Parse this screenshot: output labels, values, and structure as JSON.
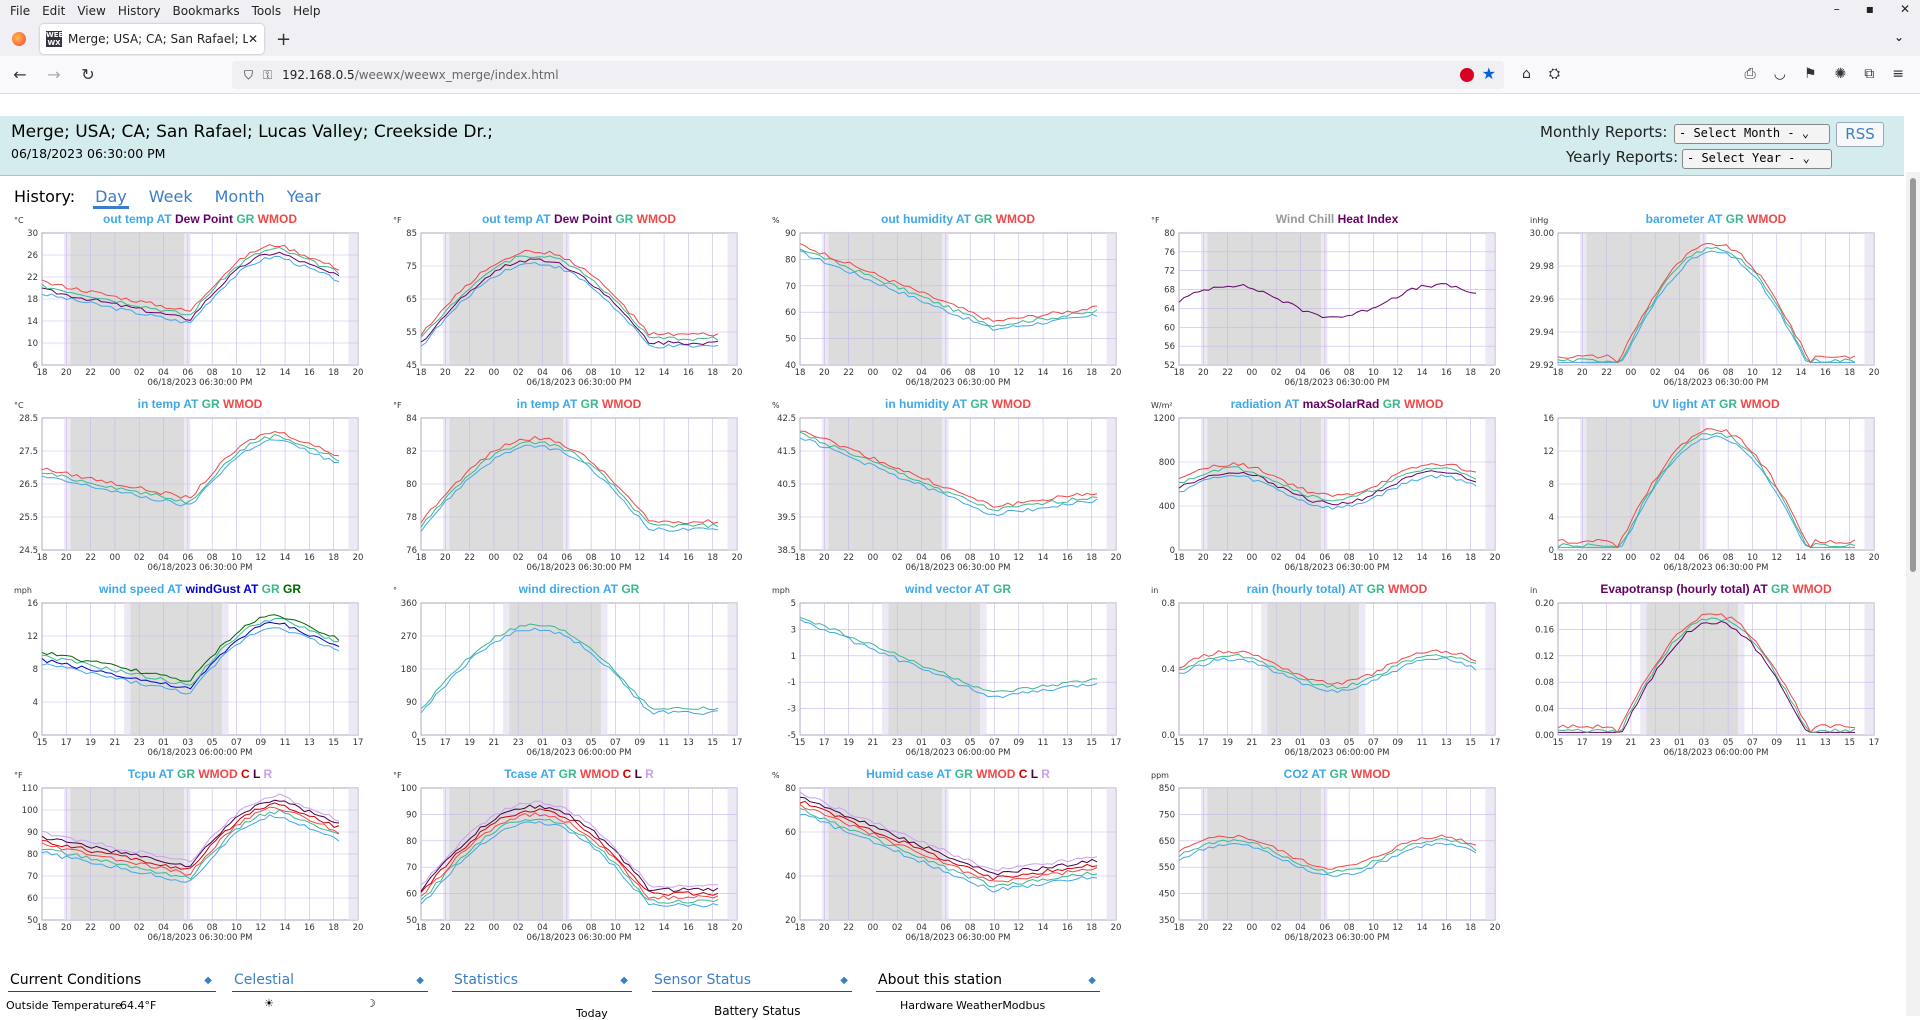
{
  "browser": {
    "menu": [
      "File",
      "Edit",
      "View",
      "History",
      "Bookmarks",
      "Tools",
      "Help"
    ],
    "window_controls": [
      "–",
      "▪",
      "✕"
    ],
    "tab_title": "Merge; USA; CA; San Rafael; Lucas Valley; Creekside Dr.;",
    "tab_favicon_text": "WEE WX",
    "url_host": "192.168.0.5",
    "url_path": "/weewx/weewx_merge/index.html"
  },
  "header": {
    "title": "Merge; USA; CA; San Rafael; Lucas Valley; Creekside Dr.;",
    "time": "06/18/2023 06:30:00 PM",
    "monthly_label": "Monthly Reports:",
    "monthly_select": "- Select Month -",
    "yearly_label": "Yearly Reports:",
    "yearly_select": "- Select Year -",
    "rss": "RSS"
  },
  "history": {
    "label": "History:",
    "tabs": [
      "Day",
      "Week",
      "Month",
      "Year"
    ],
    "active": "Day"
  },
  "colors": {
    "at": "#40a8e8",
    "gr": "#3bb88c",
    "wmod": "#f04848",
    "dew": "#660066",
    "gust": "#0000cc",
    "grgust": "#006600",
    "c": "#cc0000",
    "l": "#440044",
    "r": "#c8a0f0"
  },
  "axis_hours_a": [
    "18",
    "20",
    "22",
    "00",
    "02",
    "04",
    "06",
    "08",
    "10",
    "12",
    "14",
    "16",
    "18",
    "20"
  ],
  "axis_hours_b": [
    "15",
    "17",
    "19",
    "21",
    "23",
    "01",
    "03",
    "05",
    "07",
    "09",
    "11",
    "13",
    "15",
    "17"
  ],
  "caption_a": "06/18/2023 06:30:00 PM",
  "caption_b": "06/18/2023 06:00:00 PM",
  "plots": [
    {
      "unit": "°C",
      "yticks": [
        "30",
        "26",
        "22",
        "18",
        "14",
        "10",
        "6"
      ],
      "axis": "a",
      "title": [
        [
          "out temp AT ",
          "at"
        ],
        [
          "Dew Point ",
          "dew"
        ],
        [
          "GR ",
          "gr"
        ],
        [
          "WMOD",
          "wmod"
        ]
      ]
    },
    {
      "unit": "°F",
      "yticks": [
        "85",
        "75",
        "65",
        "55",
        "45"
      ],
      "axis": "a",
      "title": [
        [
          "out temp AT ",
          "at"
        ],
        [
          "Dew Point ",
          "dew"
        ],
        [
          "GR ",
          "gr"
        ],
        [
          "WMOD",
          "wmod"
        ]
      ]
    },
    {
      "unit": "%",
      "yticks": [
        "90",
        "80",
        "70",
        "60",
        "50",
        "40"
      ],
      "axis": "a",
      "title": [
        [
          "out humidity AT ",
          "at"
        ],
        [
          "GR ",
          "gr"
        ],
        [
          "WMOD",
          "wmod"
        ]
      ]
    },
    {
      "unit": "°F",
      "yticks": [
        "80",
        "76",
        "72",
        "68",
        "64",
        "60",
        "56",
        "52"
      ],
      "axis": "a",
      "title": [
        [
          "Wind Chill ",
          "grey"
        ],
        [
          "Heat Index",
          "dew"
        ]
      ]
    },
    {
      "unit": "inHg",
      "yticks": [
        "30.00",
        "29.98",
        "29.96",
        "29.94",
        "29.92"
      ],
      "axis": "a",
      "title": [
        [
          "barometer AT ",
          "at"
        ],
        [
          "GR ",
          "gr"
        ],
        [
          "WMOD",
          "wmod"
        ]
      ]
    },
    {
      "unit": "°C",
      "yticks": [
        "28.5",
        "27.5",
        "26.5",
        "25.5",
        "24.5"
      ],
      "axis": "a",
      "title": [
        [
          "in temp AT ",
          "at"
        ],
        [
          "GR ",
          "gr"
        ],
        [
          "WMOD",
          "wmod"
        ]
      ]
    },
    {
      "unit": "°F",
      "yticks": [
        "84",
        "82",
        "80",
        "78",
        "76"
      ],
      "axis": "a",
      "title": [
        [
          "in temp AT ",
          "at"
        ],
        [
          "GR ",
          "gr"
        ],
        [
          "WMOD",
          "wmod"
        ]
      ]
    },
    {
      "unit": "%",
      "yticks": [
        "42.5",
        "41.5",
        "40.5",
        "39.5",
        "38.5"
      ],
      "axis": "a",
      "title": [
        [
          "in humidity AT ",
          "at"
        ],
        [
          "GR ",
          "gr"
        ],
        [
          "WMOD",
          "wmod"
        ]
      ]
    },
    {
      "unit": "W/m²",
      "yticks": [
        "1200",
        "800",
        "400",
        "0"
      ],
      "axis": "a",
      "title": [
        [
          "radiation AT ",
          "at"
        ],
        [
          "maxSolarRad ",
          "dew"
        ],
        [
          "GR ",
          "gr"
        ],
        [
          "WMOD",
          "wmod"
        ]
      ]
    },
    {
      "unit": "",
      "yticks": [
        "16",
        "12",
        "8",
        "4",
        "0"
      ],
      "axis": "a",
      "title": [
        [
          "UV light AT ",
          "at"
        ],
        [
          "GR ",
          "gr"
        ],
        [
          "WMOD",
          "wmod"
        ]
      ]
    },
    {
      "unit": "mph",
      "yticks": [
        "16",
        "12",
        "8",
        "4",
        "0"
      ],
      "axis": "b",
      "title": [
        [
          "wind speed AT ",
          "at"
        ],
        [
          "windGust AT ",
          "gust"
        ],
        [
          "GR ",
          "gr"
        ],
        [
          "GR",
          "grgust"
        ]
      ]
    },
    {
      "unit": "°",
      "yticks": [
        "360",
        "270",
        "180",
        "90",
        "0"
      ],
      "axis": "b",
      "title": [
        [
          "wind direction AT ",
          "at"
        ],
        [
          "GR",
          "gr"
        ]
      ]
    },
    {
      "unit": "mph",
      "yticks": [
        "5",
        "3",
        "1",
        "-1",
        "-3",
        "-5"
      ],
      "axis": "b",
      "title": [
        [
          "wind vector AT ",
          "at"
        ],
        [
          "GR",
          "gr"
        ]
      ]
    },
    {
      "unit": "in",
      "yticks": [
        "0.8",
        "0.4",
        "0.0"
      ],
      "axis": "b",
      "title": [
        [
          "rain (hourly total) AT ",
          "at"
        ],
        [
          "GR ",
          "gr"
        ],
        [
          "WMOD",
          "wmod"
        ]
      ]
    },
    {
      "unit": "in",
      "yticks": [
        "0.20",
        "0.16",
        "0.12",
        "0.08",
        "0.04",
        "0.00"
      ],
      "axis": "b",
      "title": [
        [
          "Evapotransp (hourly total) AT ",
          "dew"
        ],
        [
          "GR ",
          "gr"
        ],
        [
          "WMOD",
          "wmod"
        ]
      ]
    },
    {
      "unit": "°F",
      "yticks": [
        "110",
        "100",
        "90",
        "80",
        "70",
        "60",
        "50"
      ],
      "axis": "a",
      "title": [
        [
          "Tcpu AT    ",
          "at"
        ],
        [
          "GR ",
          "gr"
        ],
        [
          "WMOD ",
          "wmod"
        ],
        [
          "C ",
          "c"
        ],
        [
          "L ",
          "l"
        ],
        [
          "R",
          "r"
        ]
      ]
    },
    {
      "unit": "°F",
      "yticks": [
        "100",
        "90",
        "80",
        "70",
        "60",
        "50"
      ],
      "axis": "a",
      "title": [
        [
          "Tcase AT    ",
          "at"
        ],
        [
          "GR ",
          "gr"
        ],
        [
          "WMOD ",
          "wmod"
        ],
        [
          "C ",
          "c"
        ],
        [
          "L ",
          "l"
        ],
        [
          "R",
          "r"
        ]
      ]
    },
    {
      "unit": "%",
      "yticks": [
        "80",
        "60",
        "40",
        "20"
      ],
      "axis": "a",
      "title": [
        [
          "Humid case AT    ",
          "at"
        ],
        [
          "GR ",
          "gr"
        ],
        [
          "WMOD ",
          "wmod"
        ],
        [
          "C ",
          "c"
        ],
        [
          "L ",
          "l"
        ],
        [
          "R",
          "r"
        ]
      ]
    },
    {
      "unit": "ppm",
      "yticks": [
        "850",
        "750",
        "650",
        "550",
        "450",
        "350"
      ],
      "axis": "a",
      "title": [
        [
          "CO2 AT ",
          "at"
        ],
        [
          "GR ",
          "gr"
        ],
        [
          "WMOD",
          "wmod"
        ]
      ]
    }
  ],
  "bottom": {
    "tabs": [
      "Current Conditions",
      "Celestial",
      "Statistics",
      "Sensor Status",
      "About this station"
    ],
    "outside_label": "Outside Temperature",
    "outside_value": "64.4°F",
    "sun_icon": "☀",
    "moon_icon": "☽",
    "today": "Today",
    "battery": "Battery Status",
    "hardware_label": "Hardware",
    "hardware_value": "WeatherModbus"
  }
}
